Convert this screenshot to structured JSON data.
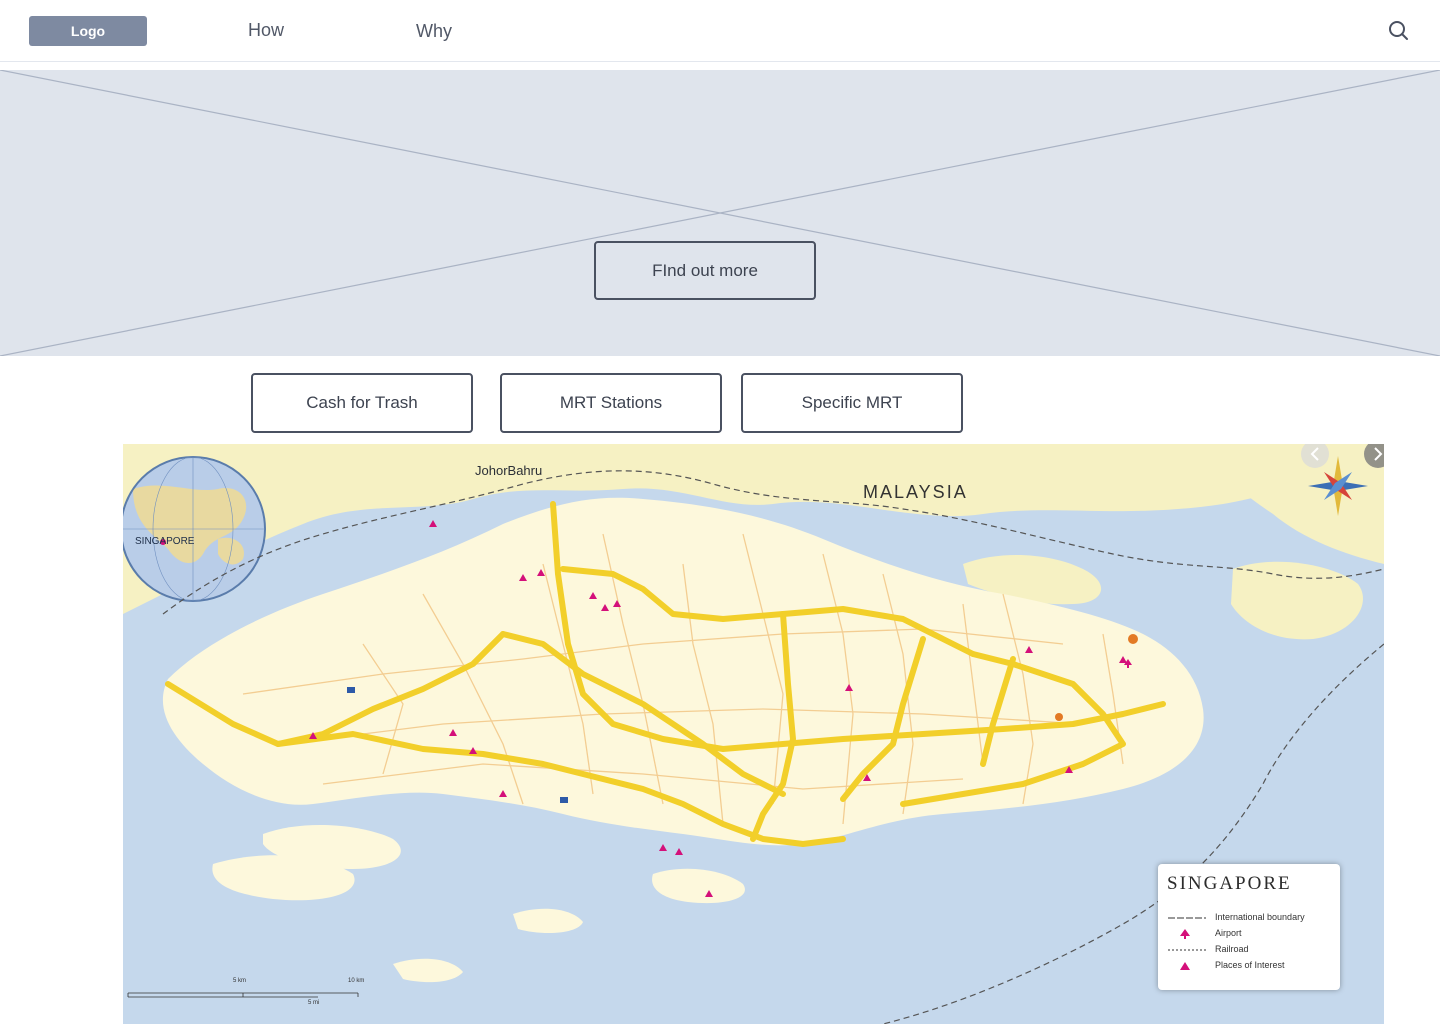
{
  "header": {
    "logo_label": "Logo",
    "nav": [
      {
        "label": "How"
      },
      {
        "label": "Why"
      }
    ],
    "search_icon": "search-icon"
  },
  "hero": {
    "cta_label": "FInd out more"
  },
  "categories": [
    {
      "label": "Cash for Trash"
    },
    {
      "label": "MRT Stations"
    },
    {
      "label": "Specific MRT"
    }
  ],
  "map": {
    "place_labels": {
      "johor": "JohorBahru",
      "malaysia": "MALAYSIA",
      "globe": "SINGAPORE"
    },
    "legend": {
      "title": "SINGAPORE",
      "items": [
        {
          "label": "International boundary",
          "symbol": "boundary-line-icon"
        },
        {
          "label": "Airport",
          "symbol": "airport-icon"
        },
        {
          "label": "Railroad",
          "symbol": "railroad-line-icon"
        },
        {
          "label": "Places of Interest",
          "symbol": "place-of-interest-icon"
        }
      ]
    },
    "scale": {
      "km_label": "5 km",
      "km10_label": "10 km",
      "mi_label": "5 mi"
    },
    "colors": {
      "water": "#c5d8ec",
      "land_malaysia": "#f6f1c3",
      "land_singapore": "#fdf8dc",
      "expressway": "#f2cf2a",
      "roads": "#f2c98a",
      "poi": "#d4107a"
    }
  }
}
